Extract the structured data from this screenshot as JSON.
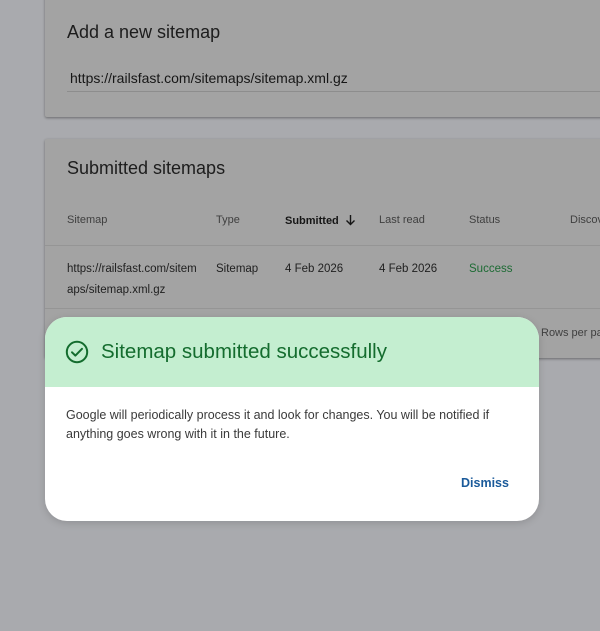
{
  "add_sitemap": {
    "title": "Add a new sitemap",
    "input_value": "https://railsfast.com/sitemaps/sitemap.xml.gz"
  },
  "submitted_sitemaps": {
    "title": "Submitted sitemaps",
    "columns": {
      "sitemap": "Sitemap",
      "type": "Type",
      "submitted": "Submitted",
      "last_read": "Last read",
      "status": "Status",
      "discovered": "Discov"
    },
    "rows": [
      {
        "sitemap": "https://railsfast.com/sitemaps/sitemap.xml.gz",
        "type": "Sitemap",
        "submitted": "4 Feb 2026",
        "last_read": "4 Feb 2026",
        "status": "Success"
      }
    ],
    "rows_per_page_label": "Rows per pa"
  },
  "dialog": {
    "title": "Sitemap submitted successfully",
    "body": "Google will periodically process it and look for changes. You will be notified if anything goes wrong with it in the future.",
    "dismiss_label": "Dismiss"
  },
  "colors": {
    "success_green": "#146c2e",
    "dialog_header_bg": "#c4eed0",
    "link_blue": "#1a5a9a",
    "overlay_bg": "#a9aaae"
  },
  "icons": {
    "dialog_icon": "check-circle-icon",
    "sort_icon": "arrow-down-icon"
  }
}
